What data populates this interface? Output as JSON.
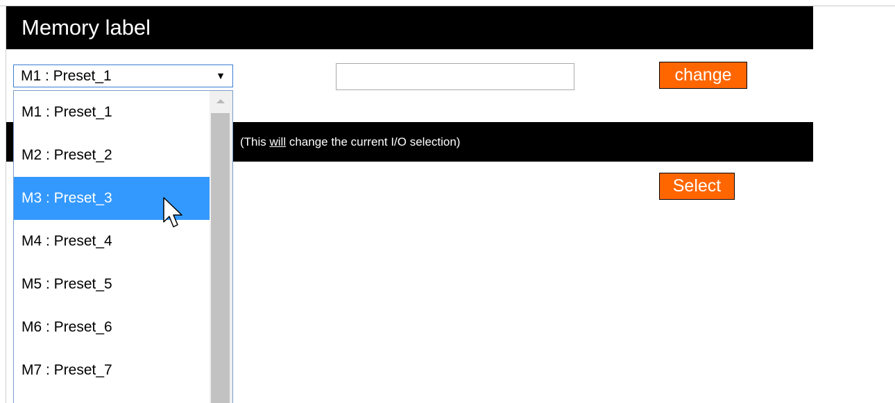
{
  "header": {
    "title": "Memory label"
  },
  "memory_select": {
    "selected": "M1 : Preset_1",
    "arrow": "▼",
    "options": [
      "M1 : Preset_1",
      "M2 : Preset_2",
      "M3 : Preset_3",
      "M4 : Preset_4",
      "M5 : Preset_5",
      "M6 : Preset_6",
      "M7 : Preset_7"
    ],
    "highlighted_index": 2
  },
  "label_input": {
    "value": "",
    "placeholder": ""
  },
  "buttons": {
    "change": "change",
    "select": "Select"
  },
  "section": {
    "note_prefix": "(This ",
    "note_emphasis": "will",
    "note_suffix": " change the current I/O selection)"
  },
  "colors": {
    "button_bg": "#ff6600",
    "highlight": "#3399ff",
    "bar_bg": "#000000"
  }
}
